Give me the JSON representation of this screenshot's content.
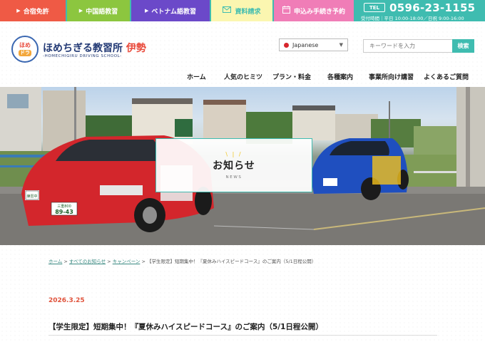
{
  "topbar": {
    "items": [
      {
        "label": "合宿免許"
      },
      {
        "label": "中国語教習"
      },
      {
        "label": "ベトナム語教習"
      },
      {
        "label": "資料請求"
      },
      {
        "label": "申込み手続き予約"
      }
    ],
    "tel_badge": "TEL",
    "tel_number": "0596-23-1155",
    "hours": "受付時間｜平日 10:00-18:00／日祝 9:00-16:00"
  },
  "logo": {
    "badge_top": "ほめ",
    "badge_bottom": "ドラ",
    "name_main": "ほめちぎる教習所",
    "name_branch": "伊勢",
    "sub": "-HOMECHIGIRU DRIVING SCHOOL-"
  },
  "language": {
    "selected": "Japanese"
  },
  "search": {
    "placeholder": "キーワードを入力",
    "button": "検索"
  },
  "nav": {
    "items": [
      "ホーム",
      "人気のヒミツ",
      "プラン・料金",
      "各種案内",
      "事業所向け講習",
      "よくあるご質問"
    ]
  },
  "hero": {
    "title": "お知らせ",
    "subtitle": "NEWS",
    "plate_left_region": "三重800",
    "plate_left_num": "89-43",
    "car_sign": "練習中"
  },
  "breadcrumb": {
    "home": "ホーム",
    "sep": ">",
    "all": "すべてのお知らせ",
    "campaign": "キャンペーン",
    "current": "【学生限定】短期集中！『夏休みハイスピードコース』のご案内（5/1日程公開）"
  },
  "article": {
    "date": "2026.3.25",
    "title": "【学生限定】短期集中！『夏休みハイスピードコース』のご案内（5/1日程公開）"
  },
  "colors": {
    "teal": "#3fbcb0",
    "red": "#ef5a45",
    "green": "#8cc63f",
    "purple": "#6b49c9",
    "yellow": "#fbf6b0",
    "pink": "#f07db7",
    "navy": "#233a75"
  },
  "icons": {
    "arrow": "triangle-right-icon",
    "mail": "mail-icon",
    "calendar": "calendar-icon"
  }
}
